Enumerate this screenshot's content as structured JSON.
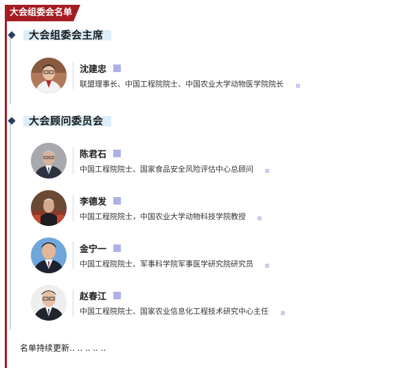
{
  "banner": {
    "title": "大会组委会名单"
  },
  "sections": [
    {
      "title": "大会组委会主席"
    },
    {
      "title": "大会顾问委员会"
    }
  ],
  "people": [
    {
      "name": "沈建忠",
      "title": "联盟理事长、中国工程院院士、中国农业大学动物医学院院长"
    },
    {
      "name": "陈君石",
      "title": "中国工程院院士、国家食品安全风险评估中心总顾问"
    },
    {
      "name": "李德发",
      "title": "中国工程院院士，中国农业大学动物科技学院教授"
    },
    {
      "name": "金宁一",
      "title": "中国工程院院士、军事科学院军事医学研究院研究员"
    },
    {
      "name": "赵春江",
      "title": "中国工程院院士、国家农业信息化工程技术研究中心主任"
    }
  ],
  "footer": {
    "text": "名单持续更新.. .. .. .. .."
  }
}
